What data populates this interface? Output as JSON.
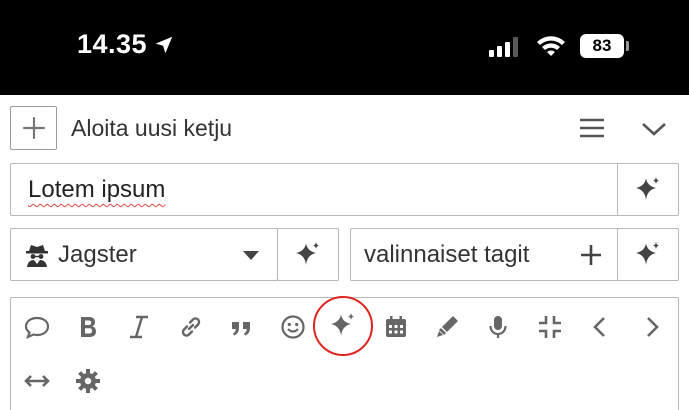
{
  "status_bar": {
    "time": "14.35",
    "battery_level": "83",
    "icons": [
      "location-arrow-icon",
      "signal-icon",
      "wifi-icon",
      "battery-icon"
    ]
  },
  "header": {
    "new_thread_label": "Aloita uusi ketju",
    "icons": [
      "plus-icon",
      "menu-icon",
      "chevron-down-icon"
    ]
  },
  "composer": {
    "title_value": "Lotem ipsum",
    "category_value": "Jagster",
    "tags_placeholder": "valinnaiset tagit"
  },
  "toolbar": {
    "row1": [
      "speech-bubble-icon",
      "bold-icon",
      "italic-icon",
      "link-icon",
      "quote-icon",
      "emoji-icon",
      "sparkle-icon",
      "calendar-icon",
      "highlighter-icon",
      "microphone-icon",
      "collapse-icon",
      "chevron-left-icon",
      "chevron-right-icon"
    ],
    "row2": [
      "arrows-horizontal-icon",
      "gear-icon"
    ]
  },
  "colors": {
    "highlight_circle": "#e0241f",
    "status_bar_bg": "#000000",
    "border": "#b8b8b8"
  }
}
